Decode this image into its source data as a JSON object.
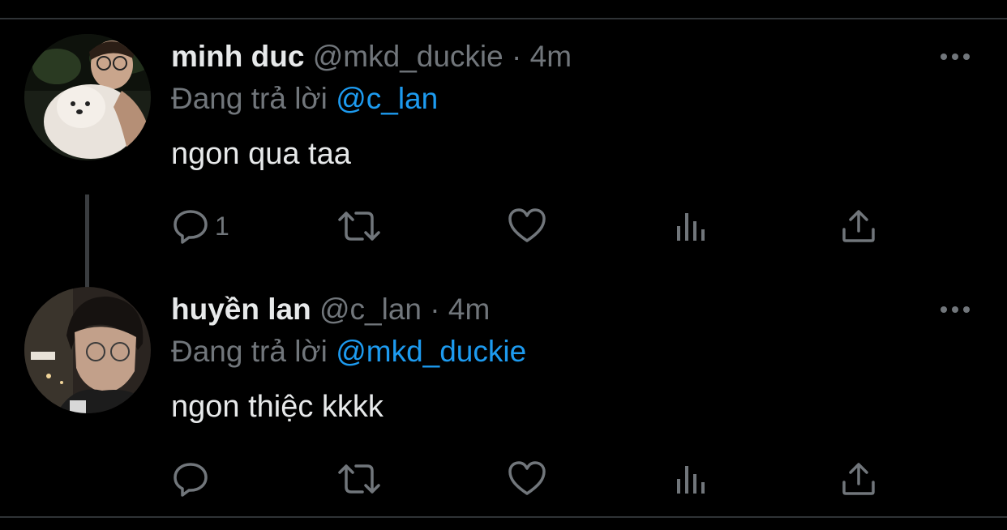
{
  "colors": {
    "background": "#000000",
    "text_primary": "#e7e9ea",
    "text_secondary": "#71767b",
    "accent": "#1d9bf0",
    "divider": "#2f3336"
  },
  "tweets": [
    {
      "display_name": "minh duc",
      "handle": "@mkd_duckie",
      "separator": "·",
      "time": "4m",
      "reply_prefix": "Đang trả lời",
      "reply_to": "@c_lan",
      "text": "ngon qua taa",
      "reply_count": "1",
      "more_icon": "more-horizontal-icon",
      "icons": [
        "reply-icon",
        "retweet-icon",
        "like-icon",
        "views-icon",
        "share-icon"
      ]
    },
    {
      "display_name": "huyền lan",
      "handle": "@c_lan",
      "separator": "·",
      "time": "4m",
      "reply_prefix": "Đang trả lời",
      "reply_to": "@mkd_duckie",
      "text": "ngon thiệc kkkk",
      "reply_count": "",
      "more_icon": "more-horizontal-icon",
      "icons": [
        "reply-icon",
        "retweet-icon",
        "like-icon",
        "views-icon",
        "share-icon"
      ]
    }
  ]
}
